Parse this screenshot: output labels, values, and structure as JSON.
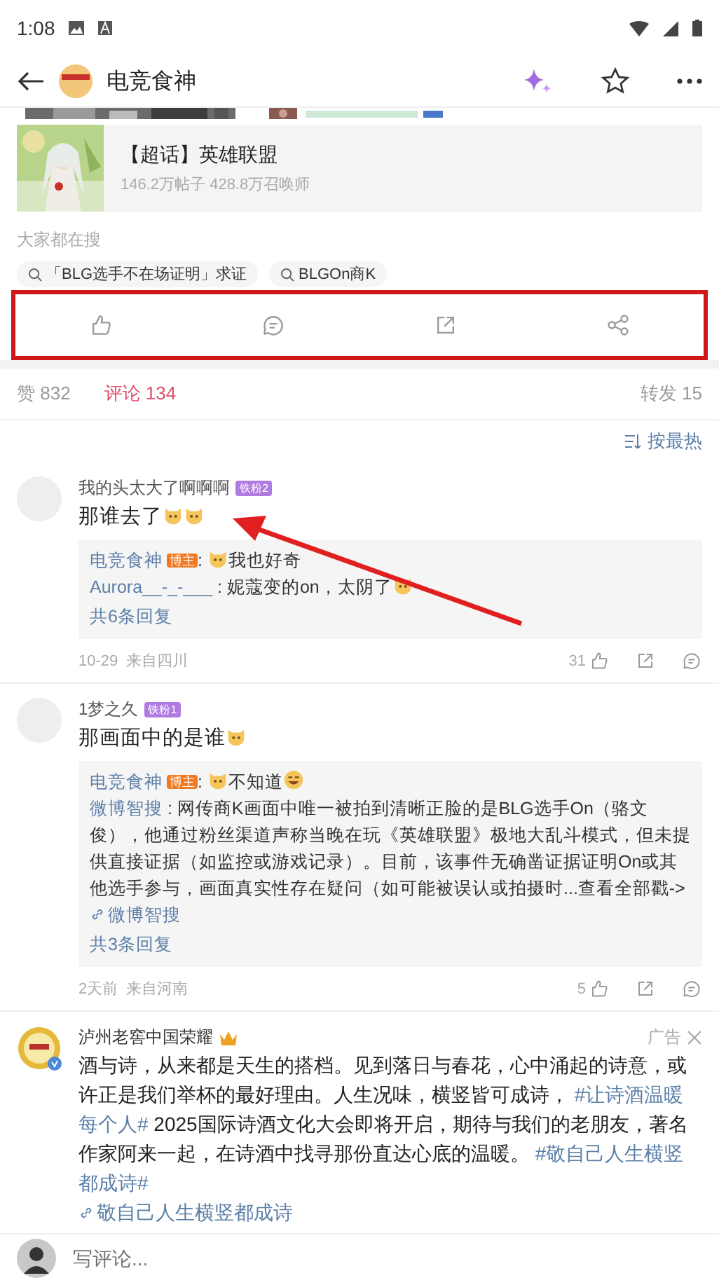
{
  "status_bar": {
    "time": "1:08"
  },
  "header": {
    "title": "电竞食神"
  },
  "topic_card": {
    "title": "【超话】英雄联盟",
    "stats": "146.2万帖子 428.8万召唤师"
  },
  "trending": {
    "label": "大家都在搜",
    "chips": [
      "「BLG选手不在场证明」求证",
      "BLGOn商K"
    ]
  },
  "stats_tabs": [
    {
      "label": "赞 832",
      "selected": false
    },
    {
      "label": "评论 134",
      "selected": true
    },
    {
      "label": "转发 15",
      "selected": false
    }
  ],
  "sort": {
    "label": "按最热"
  },
  "comments": [
    {
      "user": "我的头太大了啊啊啊",
      "badge": "铁粉2",
      "body": [
        {
          "kind": "text",
          "text": "那谁去了"
        },
        {
          "kind": "cat_emoji"
        },
        {
          "kind": "cat_emoji"
        }
      ],
      "replies": [
        {
          "author": "电竞食神",
          "author_badge": "博主",
          "content": [
            {
              "kind": "text",
              "text": ": "
            },
            {
              "kind": "cat_emoji"
            },
            {
              "kind": "text",
              "text": "我也好奇"
            }
          ]
        },
        {
          "author": "Aurora__-_-___",
          "content": [
            {
              "kind": "text",
              "text": " : 妮蔻变的on，太阴了"
            },
            {
              "kind": "cat_emoji"
            }
          ]
        }
      ],
      "reply_count": "共6条回复",
      "date": "10-29",
      "location": "来自四川",
      "likes": "31"
    },
    {
      "user": "1梦之久",
      "badge": "铁粉1",
      "body": [
        {
          "kind": "text",
          "text": "那画面中的是谁"
        },
        {
          "kind": "cat_emoji"
        }
      ],
      "replies": [
        {
          "author": "电竞食神",
          "author_badge": "博主",
          "content": [
            {
              "kind": "text",
              "text": ": "
            },
            {
              "kind": "cat_emoji"
            },
            {
              "kind": "text",
              "text": "不知道"
            },
            {
              "kind": "laugh_emoji"
            }
          ]
        },
        {
          "author": "微博智搜",
          "content": [
            {
              "kind": "text",
              "text": " : 网传商K画面中唯一被拍到清晰正脸的是BLG选手On（骆文俊），他通过粉丝渠道声称当晚在玩《英雄联盟》极地大乱斗模式，但未提供直接证据（如监控或游戏记录）。目前，该事件无确凿证据证明On或其他选手参与，画面真实性存在疑问（如可能被误认或拍摄时...查看全部戳->"
            },
            {
              "kind": "weblink",
              "text": "微博智搜"
            }
          ]
        }
      ],
      "reply_count": "共3条回复",
      "date": "2天前",
      "location": "来自河南",
      "likes": "5"
    }
  ],
  "ad": {
    "name": "泸州老窖中国荣耀",
    "label": "广告",
    "content": [
      {
        "kind": "text",
        "text": "酒与诗，从来都是天生的搭档。见到落日与春花，心中涌起的诗意，或许正是我们举杯的最好理由。人生况味，横竖皆可成诗， "
      },
      {
        "kind": "hashtag",
        "text": "#让诗酒温暖每个人#"
      },
      {
        "kind": "text",
        "text": " 2025国际诗酒文化大会即将开启，期待与我们的老朋友，著名作家阿来一起，在诗酒中找寻那份直达心底的温暖。 "
      },
      {
        "kind": "hashtag",
        "text": "#敬自己人生横竖都成诗#"
      },
      {
        "kind": "break"
      },
      {
        "kind": "weblink",
        "text": "敬自己人生横竖都成诗"
      }
    ]
  },
  "composer": {
    "placeholder": "写评论..."
  }
}
